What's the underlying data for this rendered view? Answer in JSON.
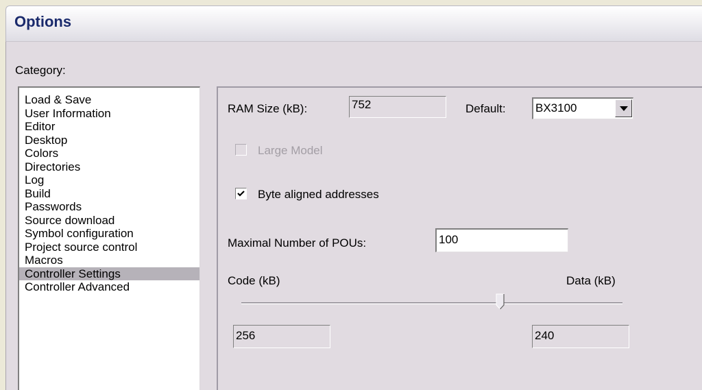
{
  "window": {
    "title": "Options"
  },
  "category": {
    "label": "Category:",
    "items": [
      "Load & Save",
      "User Information",
      "Editor",
      "Desktop",
      "Colors",
      "Directories",
      "Log",
      "Build",
      "Passwords",
      "Source download",
      "Symbol configuration",
      "Project source control",
      "Macros",
      "Controller Settings",
      "Controller Advanced"
    ],
    "selected": "Controller Settings"
  },
  "settings": {
    "ram_size_label": "RAM Size (kB):",
    "ram_size_value": "752",
    "default_label": "Default:",
    "default_value": "BX3100",
    "large_model_label": "Large Model",
    "large_model_checked": false,
    "large_model_enabled": false,
    "byte_aligned_label": "Byte aligned addresses",
    "byte_aligned_checked": true,
    "max_pous_label": "Maximal Number of POUs:",
    "max_pous_value": "100",
    "code_label": "Code (kB)",
    "data_label": "Data (kB)",
    "code_value": "256",
    "data_value": "240",
    "slider_position_fraction": 0.68
  },
  "icons": {
    "dropdown_arrow": "chevron-down-icon",
    "checkmark": "checkmark-icon"
  }
}
